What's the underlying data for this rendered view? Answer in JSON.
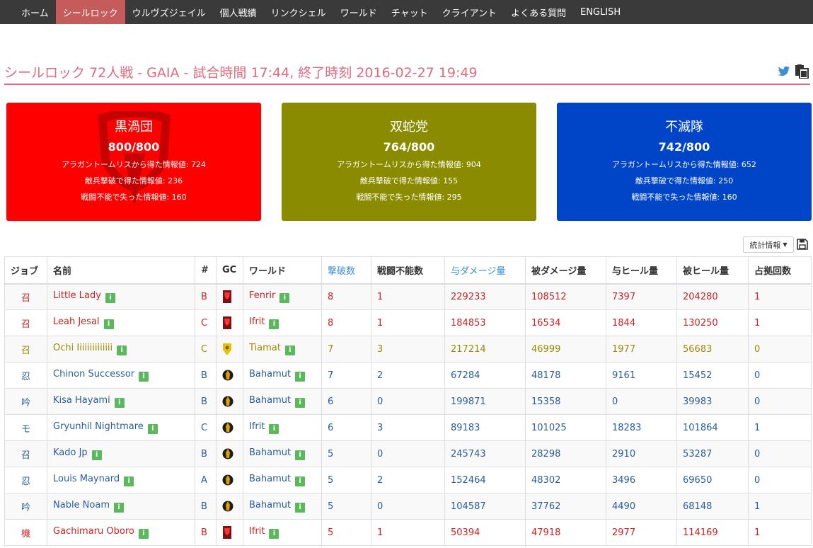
{
  "nav": {
    "items": [
      {
        "label": "ホーム",
        "active": false
      },
      {
        "label": "シールロック",
        "active": true
      },
      {
        "label": "ウルヴズジェイル",
        "active": false
      },
      {
        "label": "個人戦績",
        "active": false
      },
      {
        "label": "リンクシェル",
        "active": false
      },
      {
        "label": "ワールド",
        "active": false
      },
      {
        "label": "チャット",
        "active": false
      },
      {
        "label": "クライアント",
        "active": false
      },
      {
        "label": "よくある質問",
        "active": false
      },
      {
        "label": "ENGLISH",
        "active": false
      }
    ]
  },
  "title": "シールロック 72人戦 - GAIA - 試合時間 17:44, 終了時刻 2016-02-27 19:49",
  "title_icons": [
    "twitter-icon",
    "clipboard-icon"
  ],
  "teams": [
    {
      "name": "黒渦団",
      "score": "800/800",
      "stat1": "アラガントームリスから得た情報値: 724",
      "stat2": "敵兵撃破で得た情報値: 236",
      "stat3": "戦闘不能で失った情報値: 160",
      "color": "#ff0000"
    },
    {
      "name": "双蛇党",
      "score": "764/800",
      "stat1": "アラガントームリスから得た情報値: 904",
      "stat2": "敵兵撃破で得た情報値: 155",
      "stat3": "戦闘不能で失った情報値: 295",
      "color": "#8b8b00"
    },
    {
      "name": "不滅隊",
      "score": "742/800",
      "stat1": "アラガントームリスから得た情報値: 652",
      "stat2": "敵兵撃破で得た情報値: 250",
      "stat3": "戦闘不能で失った情報値: 160",
      "color": "#0044c8"
    }
  ],
  "stats_dropdown": {
    "label": "統計情報"
  },
  "table": {
    "headers": [
      "ジョブ",
      "名前",
      "#",
      "GC",
      "ワールド",
      "撃破数",
      "戦闘不能数",
      "与ダメージ量",
      "被ダメージ量",
      "与ヒール量",
      "被ヒール量",
      "占拠回数"
    ],
    "rows": [
      {
        "job": "召",
        "name": "Little Lady",
        "party": "B",
        "gc": "maelstrom",
        "world": "Fenrir",
        "kills": "8",
        "deaths": "1",
        "dmg_dealt": "229233",
        "dmg_taken": "108512",
        "heal_dealt": "7397",
        "heal_taken": "204280",
        "captures": "1",
        "team": "red"
      },
      {
        "job": "召",
        "name": "Leah Jesal",
        "party": "C",
        "gc": "maelstrom",
        "world": "Ifrit",
        "kills": "8",
        "deaths": "1",
        "dmg_dealt": "184853",
        "dmg_taken": "16534",
        "heal_dealt": "1844",
        "heal_taken": "130250",
        "captures": "1",
        "team": "red"
      },
      {
        "job": "召",
        "name": "Ochi Iiiiiiiiiiiiii",
        "party": "C",
        "gc": "adders",
        "world": "Tiamat",
        "kills": "7",
        "deaths": "3",
        "dmg_dealt": "217214",
        "dmg_taken": "46999",
        "heal_dealt": "1977",
        "heal_taken": "56683",
        "captures": "0",
        "team": "olive"
      },
      {
        "job": "忍",
        "name": "Chinon Successor",
        "party": "B",
        "gc": "flames",
        "world": "Bahamut",
        "kills": "7",
        "deaths": "2",
        "dmg_dealt": "67284",
        "dmg_taken": "48178",
        "heal_dealt": "9161",
        "heal_taken": "15452",
        "captures": "0",
        "team": "blue"
      },
      {
        "job": "吟",
        "name": "Kisa Hayami",
        "party": "B",
        "gc": "flames",
        "world": "Bahamut",
        "kills": "6",
        "deaths": "0",
        "dmg_dealt": "199871",
        "dmg_taken": "15358",
        "heal_dealt": "0",
        "heal_taken": "39983",
        "captures": "0",
        "team": "blue"
      },
      {
        "job": "モ",
        "name": "Gryunhil Nightmare",
        "party": "C",
        "gc": "flames",
        "world": "Ifrit",
        "kills": "6",
        "deaths": "3",
        "dmg_dealt": "89183",
        "dmg_taken": "101025",
        "heal_dealt": "18283",
        "heal_taken": "101864",
        "captures": "1",
        "team": "blue"
      },
      {
        "job": "召",
        "name": "Kado Jp",
        "party": "B",
        "gc": "flames",
        "world": "Bahamut",
        "kills": "5",
        "deaths": "0",
        "dmg_dealt": "245743",
        "dmg_taken": "28298",
        "heal_dealt": "2910",
        "heal_taken": "53287",
        "captures": "0",
        "team": "blue"
      },
      {
        "job": "忍",
        "name": "Louis Maynard",
        "party": "A",
        "gc": "flames",
        "world": "Bahamut",
        "kills": "5",
        "deaths": "2",
        "dmg_dealt": "152464",
        "dmg_taken": "48302",
        "heal_dealt": "3496",
        "heal_taken": "69650",
        "captures": "0",
        "team": "blue"
      },
      {
        "job": "吟",
        "name": "Nable Noam",
        "party": "B",
        "gc": "flames",
        "world": "Bahamut",
        "kills": "5",
        "deaths": "0",
        "dmg_dealt": "104587",
        "dmg_taken": "37762",
        "heal_dealt": "4490",
        "heal_taken": "68148",
        "captures": "1",
        "team": "blue"
      },
      {
        "job": "機",
        "name": "Gachimaru Oboro",
        "party": "B",
        "gc": "maelstrom",
        "world": "Ifrit",
        "kills": "5",
        "deaths": "1",
        "dmg_dealt": "50394",
        "dmg_taken": "47918",
        "heal_dealt": "2977",
        "heal_taken": "114169",
        "captures": "1",
        "team": "red"
      }
    ]
  }
}
